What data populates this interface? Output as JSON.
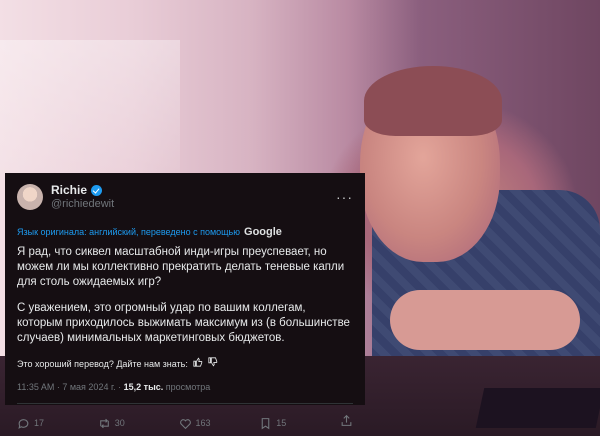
{
  "tweet": {
    "name": "Richie",
    "handle": "@richiedewit",
    "translation_note": "Язык оригинала: английский, переведено с помощью",
    "translation_service": "Google",
    "paragraph1": "Я рад, что сиквел масштабной инди-игры преуспевает, но можем ли мы коллективно прекратить делать теневые капли для столь ожидаемых игр?",
    "paragraph2": "С уважением, это огромный удар по вашим коллегам, которым приходилось выжимать максимум из (в большинстве случаев) минимальных маркетинговых бюджетов.",
    "feedback_prompt": "Это хороший перевод? Дайте нам знать:",
    "timestamp": "11:35 AM · 7 мая 2024 г. · ",
    "views_count": "15,2 тыс.",
    "views_label": "просмотра",
    "replies": "17",
    "reposts": "30",
    "likes": "163",
    "bookmarks": "15"
  },
  "icons": {
    "verified": "verified-badge-icon",
    "more": "more-icon",
    "reply": "reply-icon",
    "repost": "repost-icon",
    "like": "like-icon",
    "bookmark": "bookmark-icon",
    "share": "share-icon",
    "thumbs": [
      "thumbs-up-icon",
      "thumbs-down-icon"
    ]
  },
  "colors": {
    "card_bg": "#150e12",
    "text": "#e7e9ea",
    "muted": "#71767b",
    "link": "#1d9bf0"
  }
}
